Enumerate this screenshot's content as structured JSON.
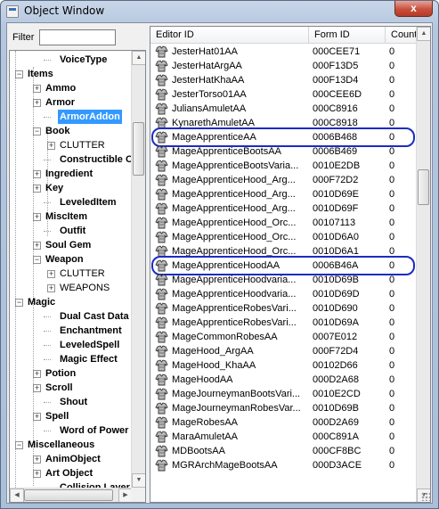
{
  "window": {
    "title": "Object Window",
    "close_label": "x"
  },
  "filter": {
    "label": "Filter",
    "value": "",
    "placeholder": ""
  },
  "tree": {
    "nodes": [
      {
        "label": "VoiceType",
        "level": 2,
        "expander": "none",
        "bold": true
      },
      {
        "label": "Items",
        "level": 0,
        "expander": "-",
        "bold": true
      },
      {
        "label": "Ammo",
        "level": 1,
        "expander": "+",
        "bold": true
      },
      {
        "label": "Armor",
        "level": 1,
        "expander": "+",
        "bold": true
      },
      {
        "label": "ArmorAddon",
        "level": 2,
        "expander": "none",
        "bold": true,
        "selected": true
      },
      {
        "label": "Book",
        "level": 1,
        "expander": "-",
        "bold": true
      },
      {
        "label": "CLUTTER",
        "level": 2,
        "expander": "+",
        "bold": false
      },
      {
        "label": "Constructible Ob",
        "level": 2,
        "expander": "none",
        "bold": true
      },
      {
        "label": "Ingredient",
        "level": 1,
        "expander": "+",
        "bold": true
      },
      {
        "label": "Key",
        "level": 1,
        "expander": "+",
        "bold": true
      },
      {
        "label": "LeveledItem",
        "level": 2,
        "expander": "none",
        "bold": true
      },
      {
        "label": "MiscItem",
        "level": 1,
        "expander": "+",
        "bold": true
      },
      {
        "label": "Outfit",
        "level": 2,
        "expander": "none",
        "bold": true
      },
      {
        "label": "Soul Gem",
        "level": 1,
        "expander": "+",
        "bold": true
      },
      {
        "label": "Weapon",
        "level": 1,
        "expander": "-",
        "bold": true
      },
      {
        "label": "CLUTTER",
        "level": 2,
        "expander": "+",
        "bold": false
      },
      {
        "label": "WEAPONS",
        "level": 2,
        "expander": "+",
        "bold": false
      },
      {
        "label": "Magic",
        "level": 0,
        "expander": "-",
        "bold": true
      },
      {
        "label": "Dual Cast Data",
        "level": 2,
        "expander": "none",
        "bold": true
      },
      {
        "label": "Enchantment",
        "level": 2,
        "expander": "none",
        "bold": true
      },
      {
        "label": "LeveledSpell",
        "level": 2,
        "expander": "none",
        "bold": true
      },
      {
        "label": "Magic Effect",
        "level": 2,
        "expander": "none",
        "bold": true
      },
      {
        "label": "Potion",
        "level": 1,
        "expander": "+",
        "bold": true
      },
      {
        "label": "Scroll",
        "level": 1,
        "expander": "+",
        "bold": true
      },
      {
        "label": "Shout",
        "level": 2,
        "expander": "none",
        "bold": true
      },
      {
        "label": "Spell",
        "level": 1,
        "expander": "+",
        "bold": true
      },
      {
        "label": "Word of Power",
        "level": 2,
        "expander": "none",
        "bold": true
      },
      {
        "label": "Miscellaneous",
        "level": 0,
        "expander": "-",
        "bold": true
      },
      {
        "label": "AnimObject",
        "level": 1,
        "expander": "+",
        "bold": true
      },
      {
        "label": "Art Object",
        "level": 1,
        "expander": "+",
        "bold": true
      },
      {
        "label": "Collision Layer",
        "level": 2,
        "expander": "none",
        "bold": true
      }
    ]
  },
  "list": {
    "columns": [
      "Editor ID",
      "Form ID",
      "Count"
    ],
    "rows": [
      {
        "editor_id": "JesterHat01AA",
        "form_id": "000CEE71",
        "count": "0"
      },
      {
        "editor_id": "JesterHatArgAA",
        "form_id": "000F13D5",
        "count": "0"
      },
      {
        "editor_id": "JesterHatKhaAA",
        "form_id": "000F13D4",
        "count": "0"
      },
      {
        "editor_id": "JesterTorso01AA",
        "form_id": "000CEE6D",
        "count": "0"
      },
      {
        "editor_id": "JuliansAmuletAA",
        "form_id": "000C8916",
        "count": "0"
      },
      {
        "editor_id": "KynarethAmuletAA",
        "form_id": "000C8918",
        "count": "0"
      },
      {
        "editor_id": "MageApprenticeAA",
        "form_id": "0006B468",
        "count": "0",
        "highlighted": true
      },
      {
        "editor_id": "MageApprenticeBootsAA",
        "form_id": "0006B469",
        "count": "0"
      },
      {
        "editor_id": "MageApprenticeBootsVaria...",
        "form_id": "0010E2DB",
        "count": "0"
      },
      {
        "editor_id": "MageApprenticeHood_Arg...",
        "form_id": "000F72D2",
        "count": "0"
      },
      {
        "editor_id": "MageApprenticeHood_Arg...",
        "form_id": "0010D69E",
        "count": "0"
      },
      {
        "editor_id": "MageApprenticeHood_Arg...",
        "form_id": "0010D69F",
        "count": "0"
      },
      {
        "editor_id": "MageApprenticeHood_Orc...",
        "form_id": "00107113",
        "count": "0"
      },
      {
        "editor_id": "MageApprenticeHood_Orc...",
        "form_id": "0010D6A0",
        "count": "0"
      },
      {
        "editor_id": "MageApprenticeHood_Orc...",
        "form_id": "0010D6A1",
        "count": "0"
      },
      {
        "editor_id": "MageApprenticeHoodAA",
        "form_id": "0006B46A",
        "count": "0",
        "highlighted": true
      },
      {
        "editor_id": "MageApprenticeHoodvaria...",
        "form_id": "0010D69B",
        "count": "0"
      },
      {
        "editor_id": "MageApprenticeHoodvaria...",
        "form_id": "0010D69D",
        "count": "0"
      },
      {
        "editor_id": "MageApprenticeRobesVari...",
        "form_id": "0010D690",
        "count": "0"
      },
      {
        "editor_id": "MageApprenticeRobesVari...",
        "form_id": "0010D69A",
        "count": "0"
      },
      {
        "editor_id": "MageCommonRobesAA",
        "form_id": "0007E012",
        "count": "0"
      },
      {
        "editor_id": "MageHood_ArgAA",
        "form_id": "000F72D4",
        "count": "0"
      },
      {
        "editor_id": "MageHood_KhaAA",
        "form_id": "00102D66",
        "count": "0"
      },
      {
        "editor_id": "MageHoodAA",
        "form_id": "000D2A68",
        "count": "0"
      },
      {
        "editor_id": "MageJourneymanBootsVari...",
        "form_id": "0010E2CD",
        "count": "0"
      },
      {
        "editor_id": "MageJourneymanRobesVar...",
        "form_id": "0010D69B",
        "count": "0"
      },
      {
        "editor_id": "MageRobesAA",
        "form_id": "000D2A69",
        "count": "0"
      },
      {
        "editor_id": "MaraAmuletAA",
        "form_id": "000C891A",
        "count": "0"
      },
      {
        "editor_id": "MDBootsAA",
        "form_id": "000CF8BC",
        "count": "0"
      },
      {
        "editor_id": "MGRArchMageBootsAA",
        "form_id": "000D3ACE",
        "count": "0"
      }
    ]
  },
  "colors": {
    "highlight_ring": "#1c2cc2",
    "selection": "#3399ff"
  },
  "icons": {
    "row_icon": "armor-icon",
    "close": "close-icon"
  }
}
